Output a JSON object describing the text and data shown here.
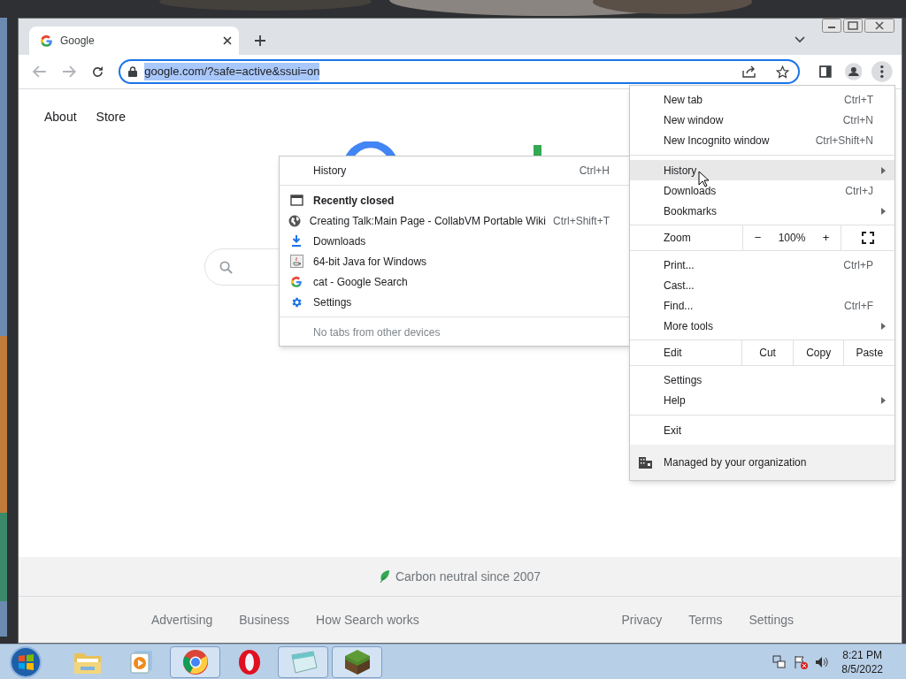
{
  "tab": {
    "title": "Google",
    "selected": true
  },
  "address_bar": {
    "value": "google.com/?safe=active&ssui=on",
    "selected": true
  },
  "page": {
    "top_links": [
      "About",
      "Store"
    ],
    "footer": {
      "carbon": "Carbon neutral since 2007",
      "left_links": [
        "Advertising",
        "Business",
        "How Search works"
      ],
      "right_links": [
        "Privacy",
        "Terms",
        "Settings"
      ]
    }
  },
  "history_menu": {
    "items": [
      {
        "kind": "item",
        "label": "History",
        "shortcut": "Ctrl+H"
      },
      {
        "kind": "separator"
      },
      {
        "kind": "header",
        "label": "Recently closed"
      },
      {
        "kind": "item",
        "label": "Creating Talk:Main Page - CollabVM Portable Wiki",
        "shortcut": "Ctrl+Shift+T"
      },
      {
        "kind": "item",
        "label": "Downloads"
      },
      {
        "kind": "item",
        "label": "64-bit Java for Windows"
      },
      {
        "kind": "item",
        "label": "cat - Google Search"
      },
      {
        "kind": "item",
        "label": "Settings"
      },
      {
        "kind": "separator"
      },
      {
        "kind": "note",
        "label": "No tabs from other devices"
      }
    ]
  },
  "main_menu": {
    "items": [
      {
        "kind": "item",
        "label": "New tab",
        "shortcut": "Ctrl+T",
        "submenu": false,
        "selected": false
      },
      {
        "kind": "item",
        "label": "New window",
        "shortcut": "Ctrl+N",
        "submenu": false,
        "selected": false
      },
      {
        "kind": "item",
        "label": "New Incognito window",
        "shortcut": "Ctrl+Shift+N",
        "submenu": false,
        "selected": false
      },
      {
        "kind": "separator"
      },
      {
        "kind": "item",
        "label": "History",
        "submenu": true,
        "selected": true
      },
      {
        "kind": "item",
        "label": "Downloads",
        "shortcut": "Ctrl+J",
        "submenu": false,
        "selected": false
      },
      {
        "kind": "item",
        "label": "Bookmarks",
        "submenu": true,
        "selected": false
      },
      {
        "kind": "zoom",
        "label": "Zoom",
        "minus": "−",
        "value": "100%",
        "plus": "+"
      },
      {
        "kind": "item",
        "label": "Print...",
        "shortcut": "Ctrl+P",
        "submenu": false,
        "selected": false
      },
      {
        "kind": "item",
        "label": "Cast...",
        "submenu": false,
        "selected": false
      },
      {
        "kind": "item",
        "label": "Find...",
        "shortcut": "Ctrl+F",
        "submenu": false,
        "selected": false
      },
      {
        "kind": "item",
        "label": "More tools",
        "submenu": true,
        "selected": false
      },
      {
        "kind": "edit",
        "label": "Edit",
        "buttons": [
          "Cut",
          "Copy",
          "Paste"
        ]
      },
      {
        "kind": "item",
        "label": "Settings",
        "submenu": false,
        "selected": false
      },
      {
        "kind": "item",
        "label": "Help",
        "submenu": true,
        "selected": false
      },
      {
        "kind": "separator"
      },
      {
        "kind": "item",
        "label": "Exit",
        "submenu": false,
        "selected": false
      },
      {
        "kind": "managed",
        "label": "Managed by your organization"
      }
    ]
  },
  "taskbar": {
    "apps": [
      {
        "running": false
      },
      {
        "running": false
      },
      {
        "running": true
      },
      {
        "running": false
      },
      {
        "running": true
      },
      {
        "running": true
      }
    ],
    "time": "8:21 PM",
    "date": "8/5/2022"
  }
}
